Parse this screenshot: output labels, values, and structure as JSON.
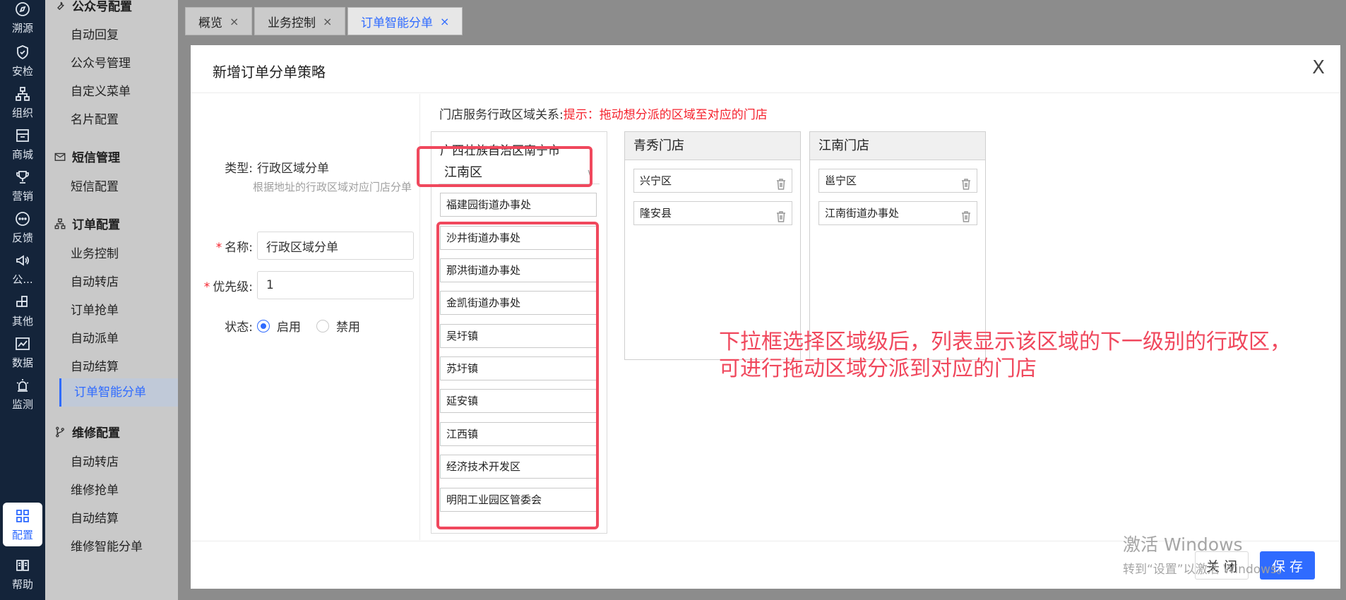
{
  "rail": [
    {
      "label": "溯源",
      "icon": "compass-icon"
    },
    {
      "label": "安检",
      "icon": "shield-check-icon"
    },
    {
      "label": "组织",
      "icon": "org-tree-icon"
    },
    {
      "label": "商城",
      "icon": "store-icon"
    },
    {
      "label": "营销",
      "icon": "trophy-icon"
    },
    {
      "label": "反馈",
      "icon": "chat-bubble-icon"
    },
    {
      "label": "公...",
      "icon": "megaphone-icon"
    },
    {
      "label": "其他",
      "icon": "blocks-icon"
    },
    {
      "label": "数据",
      "icon": "line-chart-icon"
    },
    {
      "label": "监测",
      "icon": "alarm-icon"
    },
    {
      "label": "配置",
      "icon": "grid-icon",
      "active": true
    },
    {
      "label": "帮助",
      "icon": "book-icon"
    }
  ],
  "submenu": {
    "group_wechat": "公众号配置",
    "wechat_items": [
      "自动回复",
      "公众号管理",
      "自定义菜单",
      "名片配置"
    ],
    "group_sms": "短信管理",
    "sms_items": [
      "短信配置"
    ],
    "group_order": "订单配置",
    "order_items": [
      "业务控制",
      "自动转店",
      "订单抢单",
      "自动派单",
      "自动结算",
      "订单智能分单"
    ],
    "group_repair": "维修配置",
    "repair_items": [
      "自动转店",
      "维修抢单",
      "自动结算",
      "维修智能分单"
    ]
  },
  "tabs": [
    {
      "label": "概览"
    },
    {
      "label": "业务控制"
    },
    {
      "label": "订单智能分单"
    }
  ],
  "tab_close": "×",
  "modal": {
    "title": "新增订单分单策略",
    "close": "X",
    "type_label": "类型:",
    "type_value": "行政区域分单",
    "type_hint": "根据地址的行政区域对应门店分单",
    "name_label": "名称:",
    "name_value": "行政区域分单",
    "priority_label": "优先级:",
    "priority_value": "1",
    "status_label": "状态:",
    "status_on": "启用",
    "status_off": "禁用",
    "relation_label": "门店服务行政区域关系:",
    "relation_tip": "提示：拖动想分派的区域至对应的门店",
    "region_path": "广西壮族自治区南宁市",
    "region_selected": "江南区",
    "region_first": "福建园街道办事处",
    "region_list": [
      "沙井街道办事处",
      "那洪街道办事处",
      "金凯街道办事处",
      "吴圩镇",
      "苏圩镇",
      "延安镇",
      "江西镇",
      "经济技术开发区",
      "明阳工业园区管委会"
    ],
    "store_a_name": "青秀门店",
    "store_a_items": [
      "兴宁区",
      "隆安县"
    ],
    "store_b_name": "江南门店",
    "store_b_items": [
      "邕宁区",
      "江南街道办事处"
    ],
    "annotation_line1": "下拉框选择区域级后，列表显示该区域的下一级别的行政区，",
    "annotation_line2": "可进行拖动区域分派到对应的门店",
    "btn_close": "关 闭",
    "btn_save": "保 存"
  },
  "watermark": {
    "line1": "激活 Windows",
    "line2": "转到“设置”以激活 Windows。"
  },
  "colors": {
    "accent": "#2f6bff",
    "annotation": "#f0485d",
    "rail_bg": "#14243a",
    "required": "#f5222d"
  }
}
